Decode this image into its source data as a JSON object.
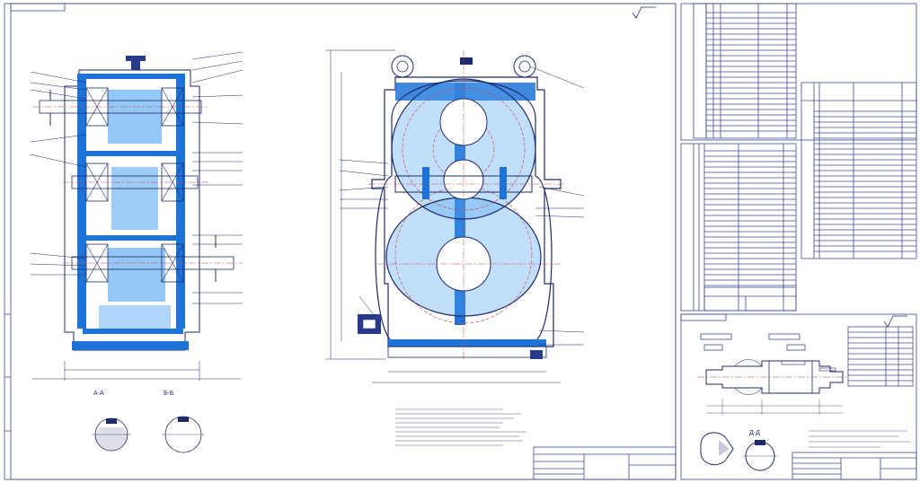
{
  "sheet": {
    "main_drawing_stamp": "",
    "section_aa_label": "А-А",
    "section_bb_label": "Б-Б",
    "detail_dd_label": "Д-Д"
  },
  "colors": {
    "section_fill": "#1e73d8",
    "light_fill": "#4da3f0",
    "line": "#1f2a6b",
    "hidden_line": "#c94040"
  },
  "leaders_left": [
    "1",
    "2",
    "3",
    "4",
    "5",
    "6",
    "7",
    "8",
    "9",
    "10",
    "11",
    "12",
    "13",
    "14",
    "15",
    "16"
  ],
  "leaders_front": [
    "1",
    "2",
    "3",
    "4",
    "5",
    "6",
    "7",
    "8",
    "9",
    "10",
    "11",
    "12",
    "13",
    "14"
  ]
}
